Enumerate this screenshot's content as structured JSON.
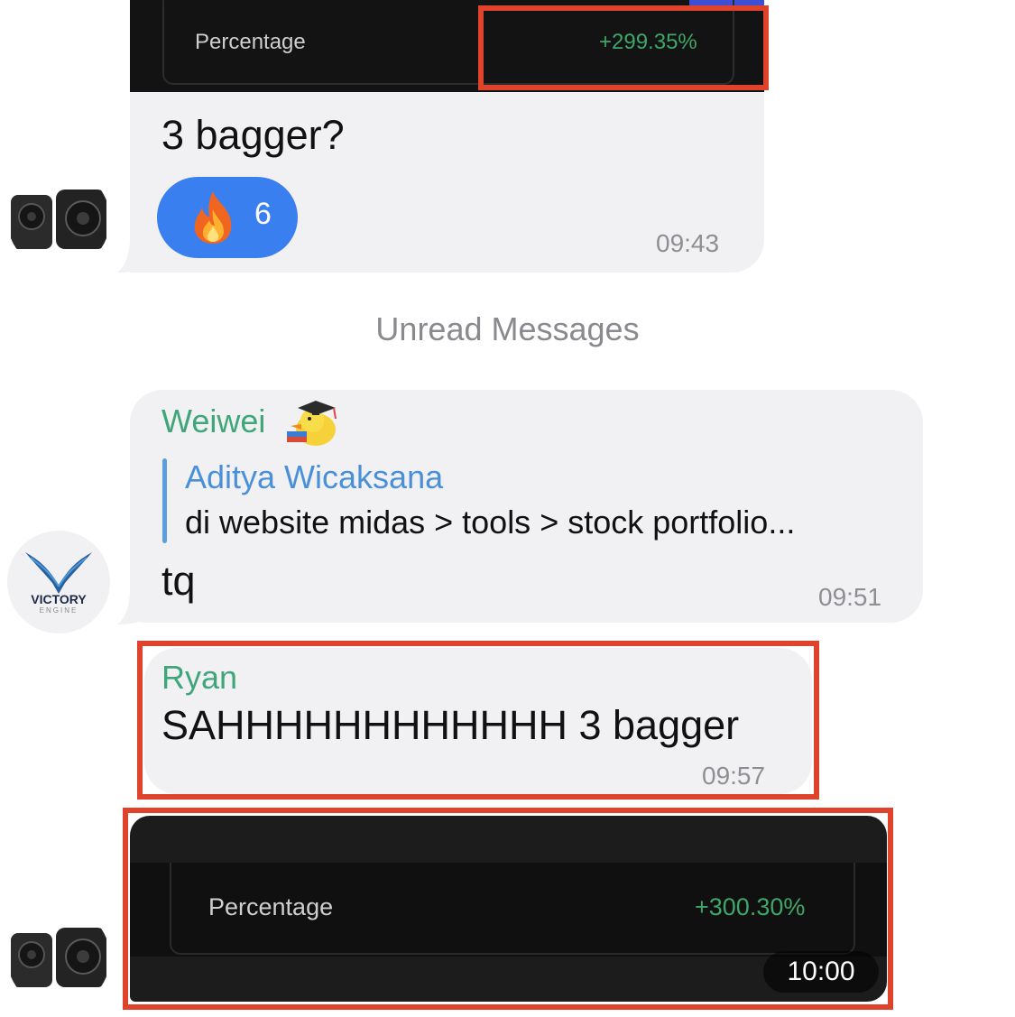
{
  "messages": {
    "m1": {
      "image": {
        "label": "Percentage",
        "value": "+299.35%"
      },
      "text": "3 bagger?",
      "reaction": {
        "emoji": "🔥",
        "count": "6"
      },
      "time": "09:43"
    },
    "divider": "Unread Messages",
    "m2": {
      "sender": "Weiwei",
      "reply_author": "Aditya Wicaksana",
      "reply_text": "di website midas > tools > stock portfolio...",
      "text": "tq",
      "time": "09:51"
    },
    "m3": {
      "sender": "Ryan",
      "text": "SAHHHHHHHHHHHH 3 bagger",
      "time": "09:57"
    },
    "m4": {
      "image": {
        "label": "Percentage",
        "value": "+300.30%"
      },
      "time": "10:00"
    }
  },
  "avatars": {
    "victory": {
      "name": "VICTORY",
      "sub": "ENGINE"
    }
  },
  "colors": {
    "bubble": "#f1f1f4",
    "sender_green": "#3fa67a",
    "reply_blue": "#4a90d9",
    "positive_green": "#3fa66a",
    "highlight_red": "#e0432b",
    "reaction_blue": "#3a7ff0"
  },
  "icons": {
    "speaker_avatar": "speaker-avatar-icon",
    "victory_avatar": "victory-engine-logo",
    "fire": "fire-icon",
    "duck_sticker": "graduation-duck-icon"
  }
}
